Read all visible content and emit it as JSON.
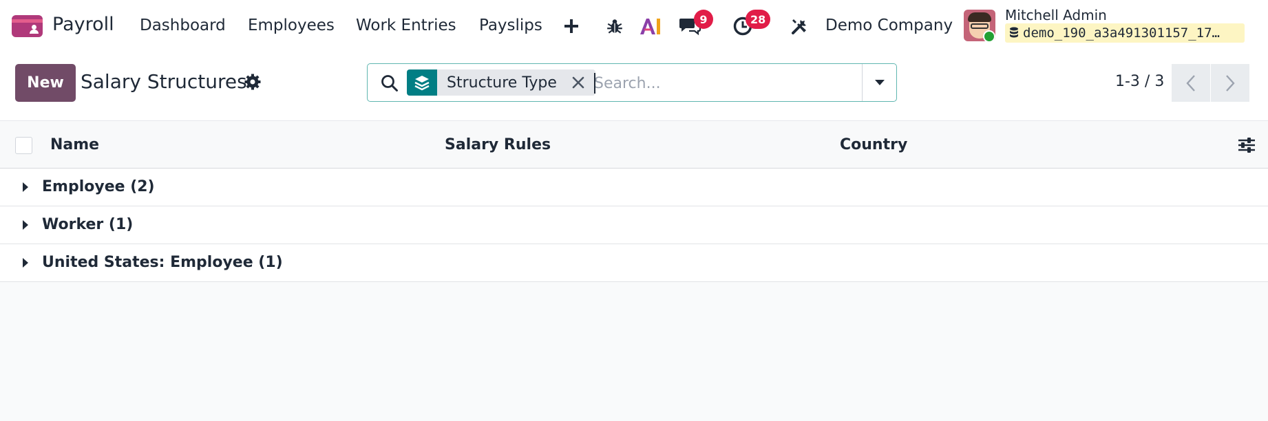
{
  "navbar": {
    "app_name": "Payroll",
    "menu": [
      {
        "label": "Dashboard"
      },
      {
        "label": "Employees"
      },
      {
        "label": "Work Entries"
      },
      {
        "label": "Payslips"
      }
    ],
    "messages_count": "9",
    "activities_count": "28",
    "company": "Demo Company",
    "user_name": "Mitchell Admin",
    "database": "demo_190_a3a491301157_17…",
    "ai_label": "AI",
    "icons": [
      "plus-icon",
      "bug-icon",
      "ai-icon",
      "chat-icon",
      "clock-icon",
      "tools-icon"
    ]
  },
  "control_panel": {
    "new_label": "New",
    "title": "Salary Structures",
    "search": {
      "facet_label": "Structure Type",
      "placeholder": "Search..."
    },
    "pager": "1-3 / 3"
  },
  "list": {
    "columns": [
      {
        "label": "Name"
      },
      {
        "label": "Salary Rules"
      },
      {
        "label": "Country"
      }
    ],
    "groups": [
      {
        "label": "Employee (2)"
      },
      {
        "label": "Worker (1)"
      },
      {
        "label": "United States: Employee (1)"
      }
    ]
  },
  "colors": {
    "primary": "#714b67",
    "facet_accent": "#017e84",
    "badge": "#e11d48",
    "db_badge": "#fdf5c3"
  }
}
